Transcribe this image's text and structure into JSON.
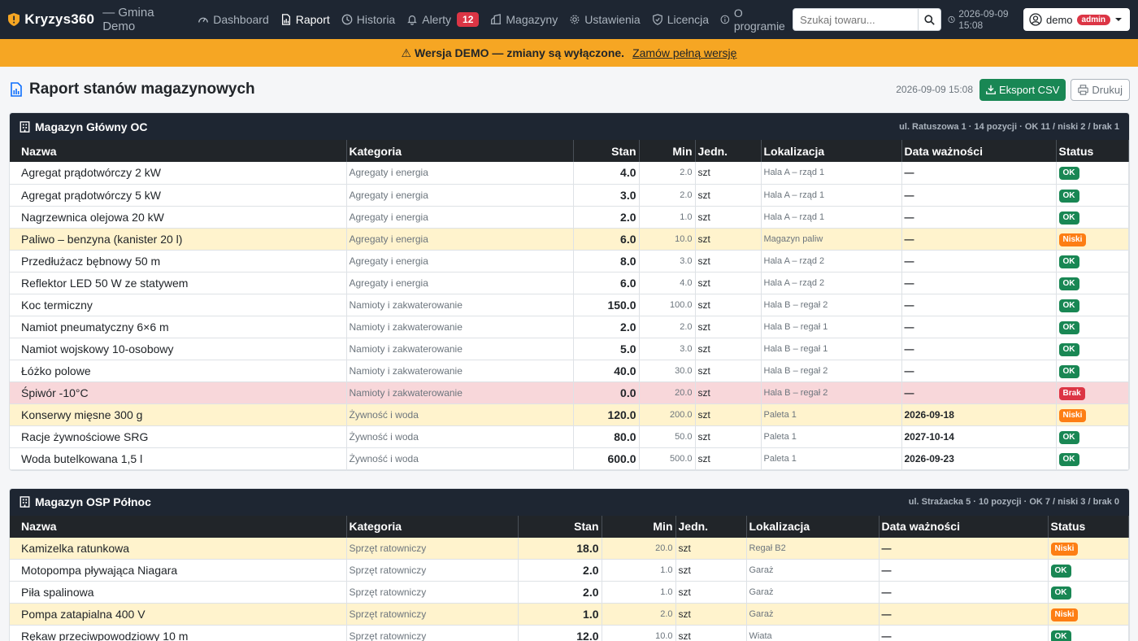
{
  "brand": {
    "name": "Kryzys360",
    "subtitle": "— Gmina Demo"
  },
  "nav": {
    "items": [
      {
        "label": "Dashboard",
        "icon": "gauge-icon"
      },
      {
        "label": "Raport",
        "icon": "report-icon",
        "active": true
      },
      {
        "label": "Historia",
        "icon": "clock-icon"
      },
      {
        "label": "Alerty",
        "icon": "bell-icon",
        "badge": "12"
      },
      {
        "label": "Magazyny",
        "icon": "building-icon"
      },
      {
        "label": "Ustawienia",
        "icon": "gear-icon"
      },
      {
        "label": "Licencja",
        "icon": "shield-icon"
      },
      {
        "label": "O programie",
        "icon": "info-icon"
      }
    ],
    "search_placeholder": "Szukaj towaru...",
    "datetime": "2026-09-09 15:08",
    "user": "demo",
    "role": "admin"
  },
  "banner": {
    "text": "Wersja DEMO — zmiany są wyłączone.",
    "link": "Zamów pełną wersję"
  },
  "page": {
    "title": "Raport stanów magazynowych",
    "timestamp": "2026-09-09 15:08",
    "export_label": "Eksport CSV",
    "print_label": "Drukuj"
  },
  "columns": [
    "Nazwa",
    "Kategoria",
    "Stan",
    "Min",
    "Jedn.",
    "Lokalizacja",
    "Data ważności",
    "Status"
  ],
  "warehouses": [
    {
      "name": "Magazyn Główny OC",
      "meta": "ul. Ratuszowa 1 · 14 pozycji · OK 11 / niski 2 / brak 1",
      "rows": [
        {
          "name": "Agregat prądotwórczy 2 kW",
          "cat": "Agregaty i energia",
          "stan": "4.0",
          "min": "2.0",
          "jedn": "szt",
          "lok": "Hala A – rząd 1",
          "data": "—",
          "status": "OK"
        },
        {
          "name": "Agregat prądotwórczy 5 kW",
          "cat": "Agregaty i energia",
          "stan": "3.0",
          "min": "2.0",
          "jedn": "szt",
          "lok": "Hala A – rząd 1",
          "data": "—",
          "status": "OK"
        },
        {
          "name": "Nagrzewnica olejowa 20 kW",
          "cat": "Agregaty i energia",
          "stan": "2.0",
          "min": "1.0",
          "jedn": "szt",
          "lok": "Hala A – rząd 1",
          "data": "—",
          "status": "OK"
        },
        {
          "name": "Paliwo – benzyna (kanister 20 l)",
          "cat": "Agregaty i energia",
          "stan": "6.0",
          "min": "10.0",
          "jedn": "szt",
          "lok": "Magazyn paliw",
          "data": "—",
          "status": "Niski"
        },
        {
          "name": "Przedłużacz bębnowy 50 m",
          "cat": "Agregaty i energia",
          "stan": "8.0",
          "min": "3.0",
          "jedn": "szt",
          "lok": "Hala A – rząd 2",
          "data": "—",
          "status": "OK"
        },
        {
          "name": "Reflektor LED 50 W ze statywem",
          "cat": "Agregaty i energia",
          "stan": "6.0",
          "min": "4.0",
          "jedn": "szt",
          "lok": "Hala A – rząd 2",
          "data": "—",
          "status": "OK"
        },
        {
          "name": "Koc termiczny",
          "cat": "Namioty i zakwaterowanie",
          "stan": "150.0",
          "min": "100.0",
          "jedn": "szt",
          "lok": "Hala B – regał 2",
          "data": "—",
          "status": "OK"
        },
        {
          "name": "Namiot pneumatyczny 6×6 m",
          "cat": "Namioty i zakwaterowanie",
          "stan": "2.0",
          "min": "2.0",
          "jedn": "szt",
          "lok": "Hala B – regał 1",
          "data": "—",
          "status": "OK"
        },
        {
          "name": "Namiot wojskowy 10-osobowy",
          "cat": "Namioty i zakwaterowanie",
          "stan": "5.0",
          "min": "3.0",
          "jedn": "szt",
          "lok": "Hala B – regał 1",
          "data": "—",
          "status": "OK"
        },
        {
          "name": "Łóżko polowe",
          "cat": "Namioty i zakwaterowanie",
          "stan": "40.0",
          "min": "30.0",
          "jedn": "szt",
          "lok": "Hala B – regał 2",
          "data": "—",
          "status": "OK"
        },
        {
          "name": "Śpiwór -10°C",
          "cat": "Namioty i zakwaterowanie",
          "stan": "0.0",
          "min": "20.0",
          "jedn": "szt",
          "lok": "Hala B – regał 2",
          "data": "—",
          "status": "Brak"
        },
        {
          "name": "Konserwy mięsne 300 g",
          "cat": "Żywność i woda",
          "stan": "120.0",
          "min": "200.0",
          "jedn": "szt",
          "lok": "Paleta 1",
          "data": "2026-09-18",
          "status": "Niski"
        },
        {
          "name": "Racje żywnościowe SRG",
          "cat": "Żywność i woda",
          "stan": "80.0",
          "min": "50.0",
          "jedn": "szt",
          "lok": "Paleta 1",
          "data": "2027-10-14",
          "status": "OK"
        },
        {
          "name": "Woda butelkowana 1,5 l",
          "cat": "Żywność i woda",
          "stan": "600.0",
          "min": "500.0",
          "jedn": "szt",
          "lok": "Paleta 1",
          "data": "2026-09-23",
          "status": "OK"
        }
      ]
    },
    {
      "name": "Magazyn OSP Północ",
      "meta": "ul. Strażacka 5 · 10 pozycji · OK 7 / niski 3 / brak 0",
      "rows": [
        {
          "name": "Kamizelka ratunkowa",
          "cat": "Sprzęt ratowniczy",
          "stan": "18.0",
          "min": "20.0",
          "jedn": "szt",
          "lok": "Regał B2",
          "data": "—",
          "status": "Niski"
        },
        {
          "name": "Motopompa pływająca Niagara",
          "cat": "Sprzęt ratowniczy",
          "stan": "2.0",
          "min": "1.0",
          "jedn": "szt",
          "lok": "Garaż",
          "data": "—",
          "status": "OK"
        },
        {
          "name": "Piła spalinowa",
          "cat": "Sprzęt ratowniczy",
          "stan": "2.0",
          "min": "1.0",
          "jedn": "szt",
          "lok": "Garaż",
          "data": "—",
          "status": "OK"
        },
        {
          "name": "Pompa zatapialna 400 V",
          "cat": "Sprzęt ratowniczy",
          "stan": "1.0",
          "min": "2.0",
          "jedn": "szt",
          "lok": "Garaż",
          "data": "—",
          "status": "Niski"
        },
        {
          "name": "Rękaw przeciwpowodziowy 10 m",
          "cat": "Sprzęt ratowniczy",
          "stan": "12.0",
          "min": "10.0",
          "jedn": "szt",
          "lok": "Wiata",
          "data": "—",
          "status": "OK"
        }
      ]
    }
  ]
}
